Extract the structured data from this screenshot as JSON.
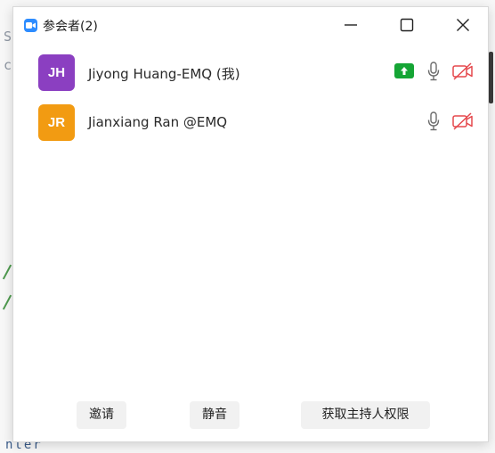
{
  "background": {
    "left_glyph_1": "S",
    "left_glyph_2": "c",
    "bottom_text": "nter"
  },
  "window": {
    "title": "参会者(2)",
    "controls": {
      "minimize": "minimize-icon",
      "maximize": "maximize-icon",
      "close": "close-icon"
    }
  },
  "participants": [
    {
      "initials": "JH",
      "name": "Jiyong Huang-EMQ (我)",
      "avatar_color": "#8b3fc1",
      "screen_share": true,
      "mic": "mic-icon",
      "video": "video-off-icon"
    },
    {
      "initials": "JR",
      "name": "Jianxiang Ran @EMQ",
      "avatar_color": "#f29b12",
      "screen_share": false,
      "mic": "mic-icon",
      "video": "video-off-icon"
    }
  ],
  "footer": {
    "invite_label": "邀请",
    "mute_label": "静音",
    "claim_host_label": "获取主持人权限"
  },
  "colors": {
    "app_accent": "#2d8cff",
    "share_green": "#15a535",
    "video_off_red": "#e5484d"
  }
}
